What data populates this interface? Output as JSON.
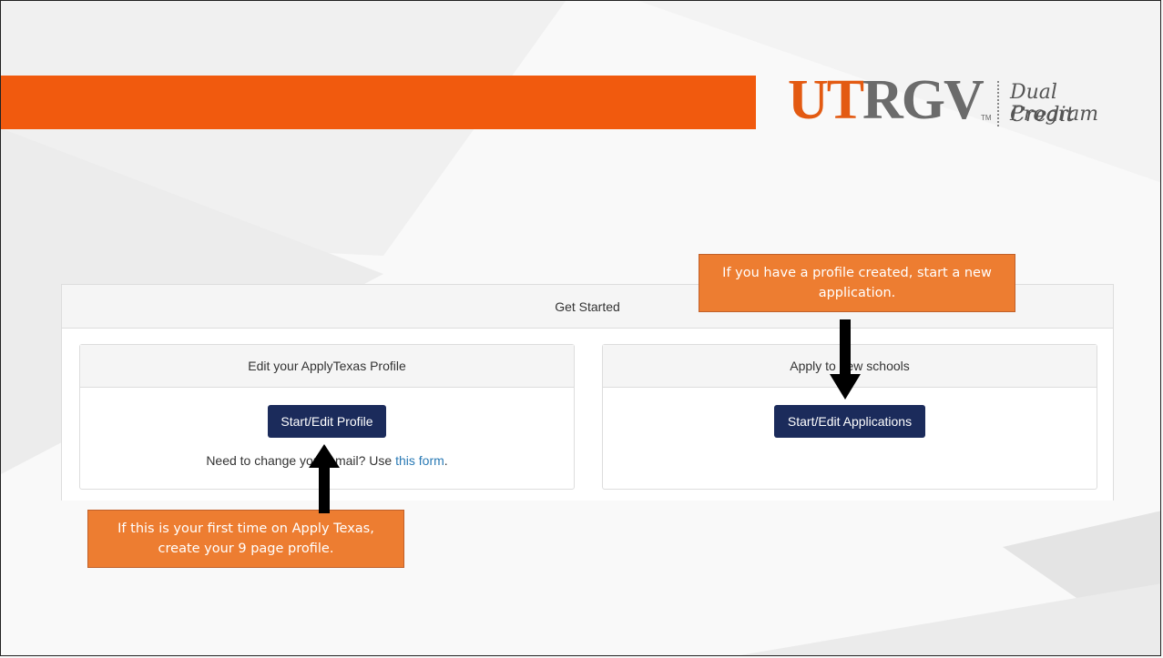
{
  "logo": {
    "ut": "UT",
    "rgv": "RGV",
    "tm": "TM",
    "program_line1": "Dual Credit",
    "program_line2": "Program"
  },
  "colors": {
    "orange_bar": "#f15a0e",
    "callout": "#ed7d31",
    "button": "#1b2b5b",
    "link": "#2a7ab5"
  },
  "panel": {
    "header": "Get Started",
    "cards": [
      {
        "title": "Edit your ApplyTexas Profile",
        "button_label": "Start/Edit Profile",
        "note_prefix": "Need to change your email? Use ",
        "note_link": "this form",
        "note_suffix": "."
      },
      {
        "title": "Apply to new schools",
        "button_label": "Start/Edit Applications"
      }
    ]
  },
  "callouts": {
    "top": "If you have a profile created, start a new application.",
    "bottom": "If this is your first time on Apply Texas, create your 9 page profile."
  }
}
